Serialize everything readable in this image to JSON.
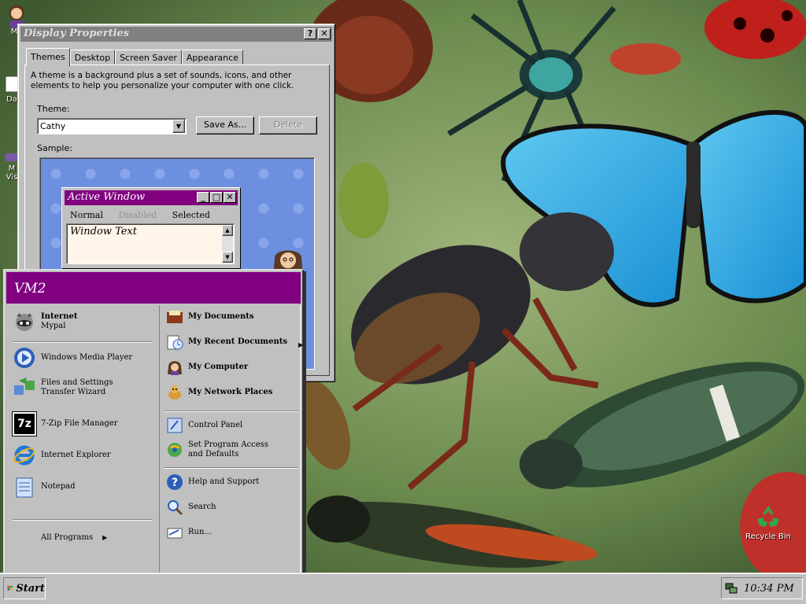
{
  "desktop": {
    "icons": [
      {
        "label": "My",
        "icon": "user-icon"
      },
      {
        "label": "Da",
        "icon": "document-icon"
      },
      {
        "label": "M\nVis",
        "icon": "studio-icon"
      },
      {
        "label": "Recycle Bin",
        "icon": "recycle-bin-icon"
      }
    ]
  },
  "dialog": {
    "title": "Display Properties",
    "help_btn": "?",
    "close_btn": "✕",
    "tabs": [
      "Themes",
      "Desktop",
      "Screen Saver",
      "Appearance"
    ],
    "active_tab": "Themes",
    "description": "A theme is a background plus a set of sounds, icons, and other elements to help you personalize your computer with one click.",
    "theme_label": "Theme:",
    "theme_value": "Cathy",
    "save_as": "Save As...",
    "delete": "Delete",
    "sample_label": "Sample:",
    "preview": {
      "title": "Active Window",
      "menu": [
        "Normal",
        "Disabled",
        "Selected"
      ],
      "text": "Window Text"
    }
  },
  "start_menu": {
    "user": "VM2",
    "pinned": [
      {
        "title": "Internet",
        "subtitle": "Mypal",
        "icon": "raccoon-browser-icon"
      }
    ],
    "recent": [
      {
        "label": "Windows Media Player",
        "icon": "media-player-icon"
      },
      {
        "label": "Files and Settings Transfer Wizard",
        "icon": "transfer-wizard-icon"
      },
      {
        "label": "7-Zip File Manager",
        "icon": "7zip-icon",
        "glyph": "7z"
      },
      {
        "label": "Internet Explorer",
        "icon": "internet-explorer-icon"
      },
      {
        "label": "Notepad",
        "icon": "notepad-icon"
      }
    ],
    "all_programs": "All Programs",
    "places": [
      {
        "label": "My Documents",
        "icon": "my-documents-icon"
      },
      {
        "label": "My Recent Documents",
        "icon": "recent-documents-icon"
      },
      {
        "label": "My Computer",
        "icon": "my-computer-icon"
      },
      {
        "label": "My Network Places",
        "icon": "network-places-icon"
      }
    ],
    "system": [
      {
        "label": "Control Panel",
        "icon": "control-panel-icon"
      },
      {
        "label": "Set Program Access and Defaults",
        "icon": "program-access-icon"
      }
    ],
    "tools": [
      {
        "label": "Help and Support",
        "icon": "help-icon"
      },
      {
        "label": "Search",
        "icon": "search-icon"
      },
      {
        "label": "Run...",
        "icon": "run-icon"
      }
    ]
  },
  "taskbar": {
    "start_label": "Start",
    "clock": "10:34 PM"
  },
  "colors": {
    "accent": "#800080",
    "face": "#c0c0c0",
    "sample_bg": "#6d8fe0"
  }
}
